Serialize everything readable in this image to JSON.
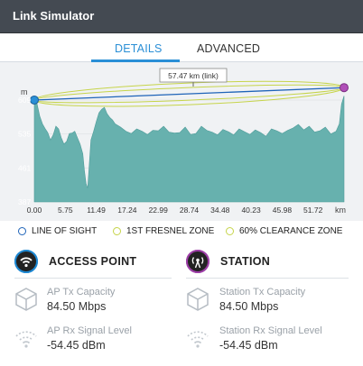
{
  "window": {
    "title": "Link Simulator"
  },
  "tabs": [
    {
      "label": "DETAILS",
      "active": true
    },
    {
      "label": "ADVANCED",
      "active": false
    }
  ],
  "chart": {
    "link_label": "57.47 km (link)",
    "y_unit": "m",
    "x_unit": "km",
    "y_ticks": [
      "609",
      "535",
      "461",
      "387"
    ],
    "x_ticks": [
      "0.00",
      "5.75",
      "11.49",
      "17.24",
      "22.99",
      "28.74",
      "34.48",
      "40.23",
      "45.98",
      "51.72"
    ],
    "colors": {
      "terrain_fill": "#67b1ae",
      "line_of_sight": "#1e63b8",
      "fresnel": "#c6d44a",
      "ap_endpoint": "#2a8fd6",
      "station_endpoint": "#b04fb8"
    }
  },
  "chart_data": {
    "type": "area",
    "title": "",
    "xlabel": "km",
    "ylabel": "m",
    "xlim": [
      0,
      57.47
    ],
    "ylim": [
      387,
      660
    ],
    "x": [
      0.0,
      0.5,
      1.0,
      1.5,
      2.0,
      2.5,
      3.0,
      3.5,
      4.0,
      4.5,
      5.0,
      5.5,
      6.0,
      6.5,
      7.0,
      7.5,
      8.0,
      8.5,
      9.0,
      9.3,
      9.6,
      9.9,
      10.2,
      10.5,
      11.0,
      11.5,
      12.0,
      12.5,
      13.0,
      13.5,
      14.0,
      14.5,
      15.0,
      16.0,
      17.0,
      18.0,
      19.0,
      20.0,
      21.0,
      22.0,
      23.0,
      24.0,
      25.0,
      26.0,
      27.0,
      28.0,
      29.0,
      30.0,
      31.0,
      32.0,
      33.0,
      34.0,
      35.0,
      36.0,
      37.0,
      38.0,
      39.0,
      40.0,
      41.0,
      42.0,
      43.0,
      44.0,
      45.0,
      46.0,
      47.0,
      48.0,
      49.0,
      50.0,
      51.0,
      52.0,
      53.0,
      54.0,
      55.0,
      56.0,
      56.6,
      57.0,
      57.47
    ],
    "y": [
      609,
      601,
      574,
      557,
      547,
      538,
      522,
      533,
      552,
      546,
      527,
      513,
      519,
      536,
      537,
      541,
      527,
      513,
      492,
      455,
      427,
      417,
      469,
      522,
      541,
      562,
      581,
      589,
      593,
      579,
      571,
      566,
      557,
      550,
      541,
      536,
      546,
      541,
      534,
      543,
      542,
      552,
      539,
      537,
      538,
      550,
      534,
      536,
      552,
      543,
      539,
      533,
      545,
      540,
      533,
      546,
      540,
      534,
      544,
      538,
      530,
      546,
      542,
      536,
      543,
      548,
      556,
      544,
      552,
      539,
      542,
      550,
      535,
      541,
      557,
      600,
      618
    ],
    "endpoints": {
      "ap_height": 609,
      "station_height": 636
    },
    "legend": [
      "LINE OF SIGHT",
      "1ST FRESNEL ZONE",
      "60% CLEARANCE ZONE"
    ],
    "grid": true
  },
  "legend": {
    "line_of_sight": "LINE OF SIGHT",
    "fresnel": "1ST FRESNEL ZONE",
    "clearance": "60% CLEARANCE ZONE"
  },
  "access_point": {
    "title": "ACCESS POINT",
    "tx_label": "AP Tx Capacity",
    "tx_value": "84.50 Mbps",
    "rx_label": "AP Rx Signal Level",
    "rx_value": "-54.45 dBm",
    "icon": "wifi-icon",
    "icon_bg": "#1e88d2"
  },
  "station": {
    "title": "STATION",
    "tx_label": "Station Tx Capacity",
    "tx_value": "84.50 Mbps",
    "rx_label": "Station Rx Signal Level",
    "rx_value": "-54.45 dBm",
    "icon": "station-antenna-icon",
    "icon_bg": "#9c3ea6"
  }
}
